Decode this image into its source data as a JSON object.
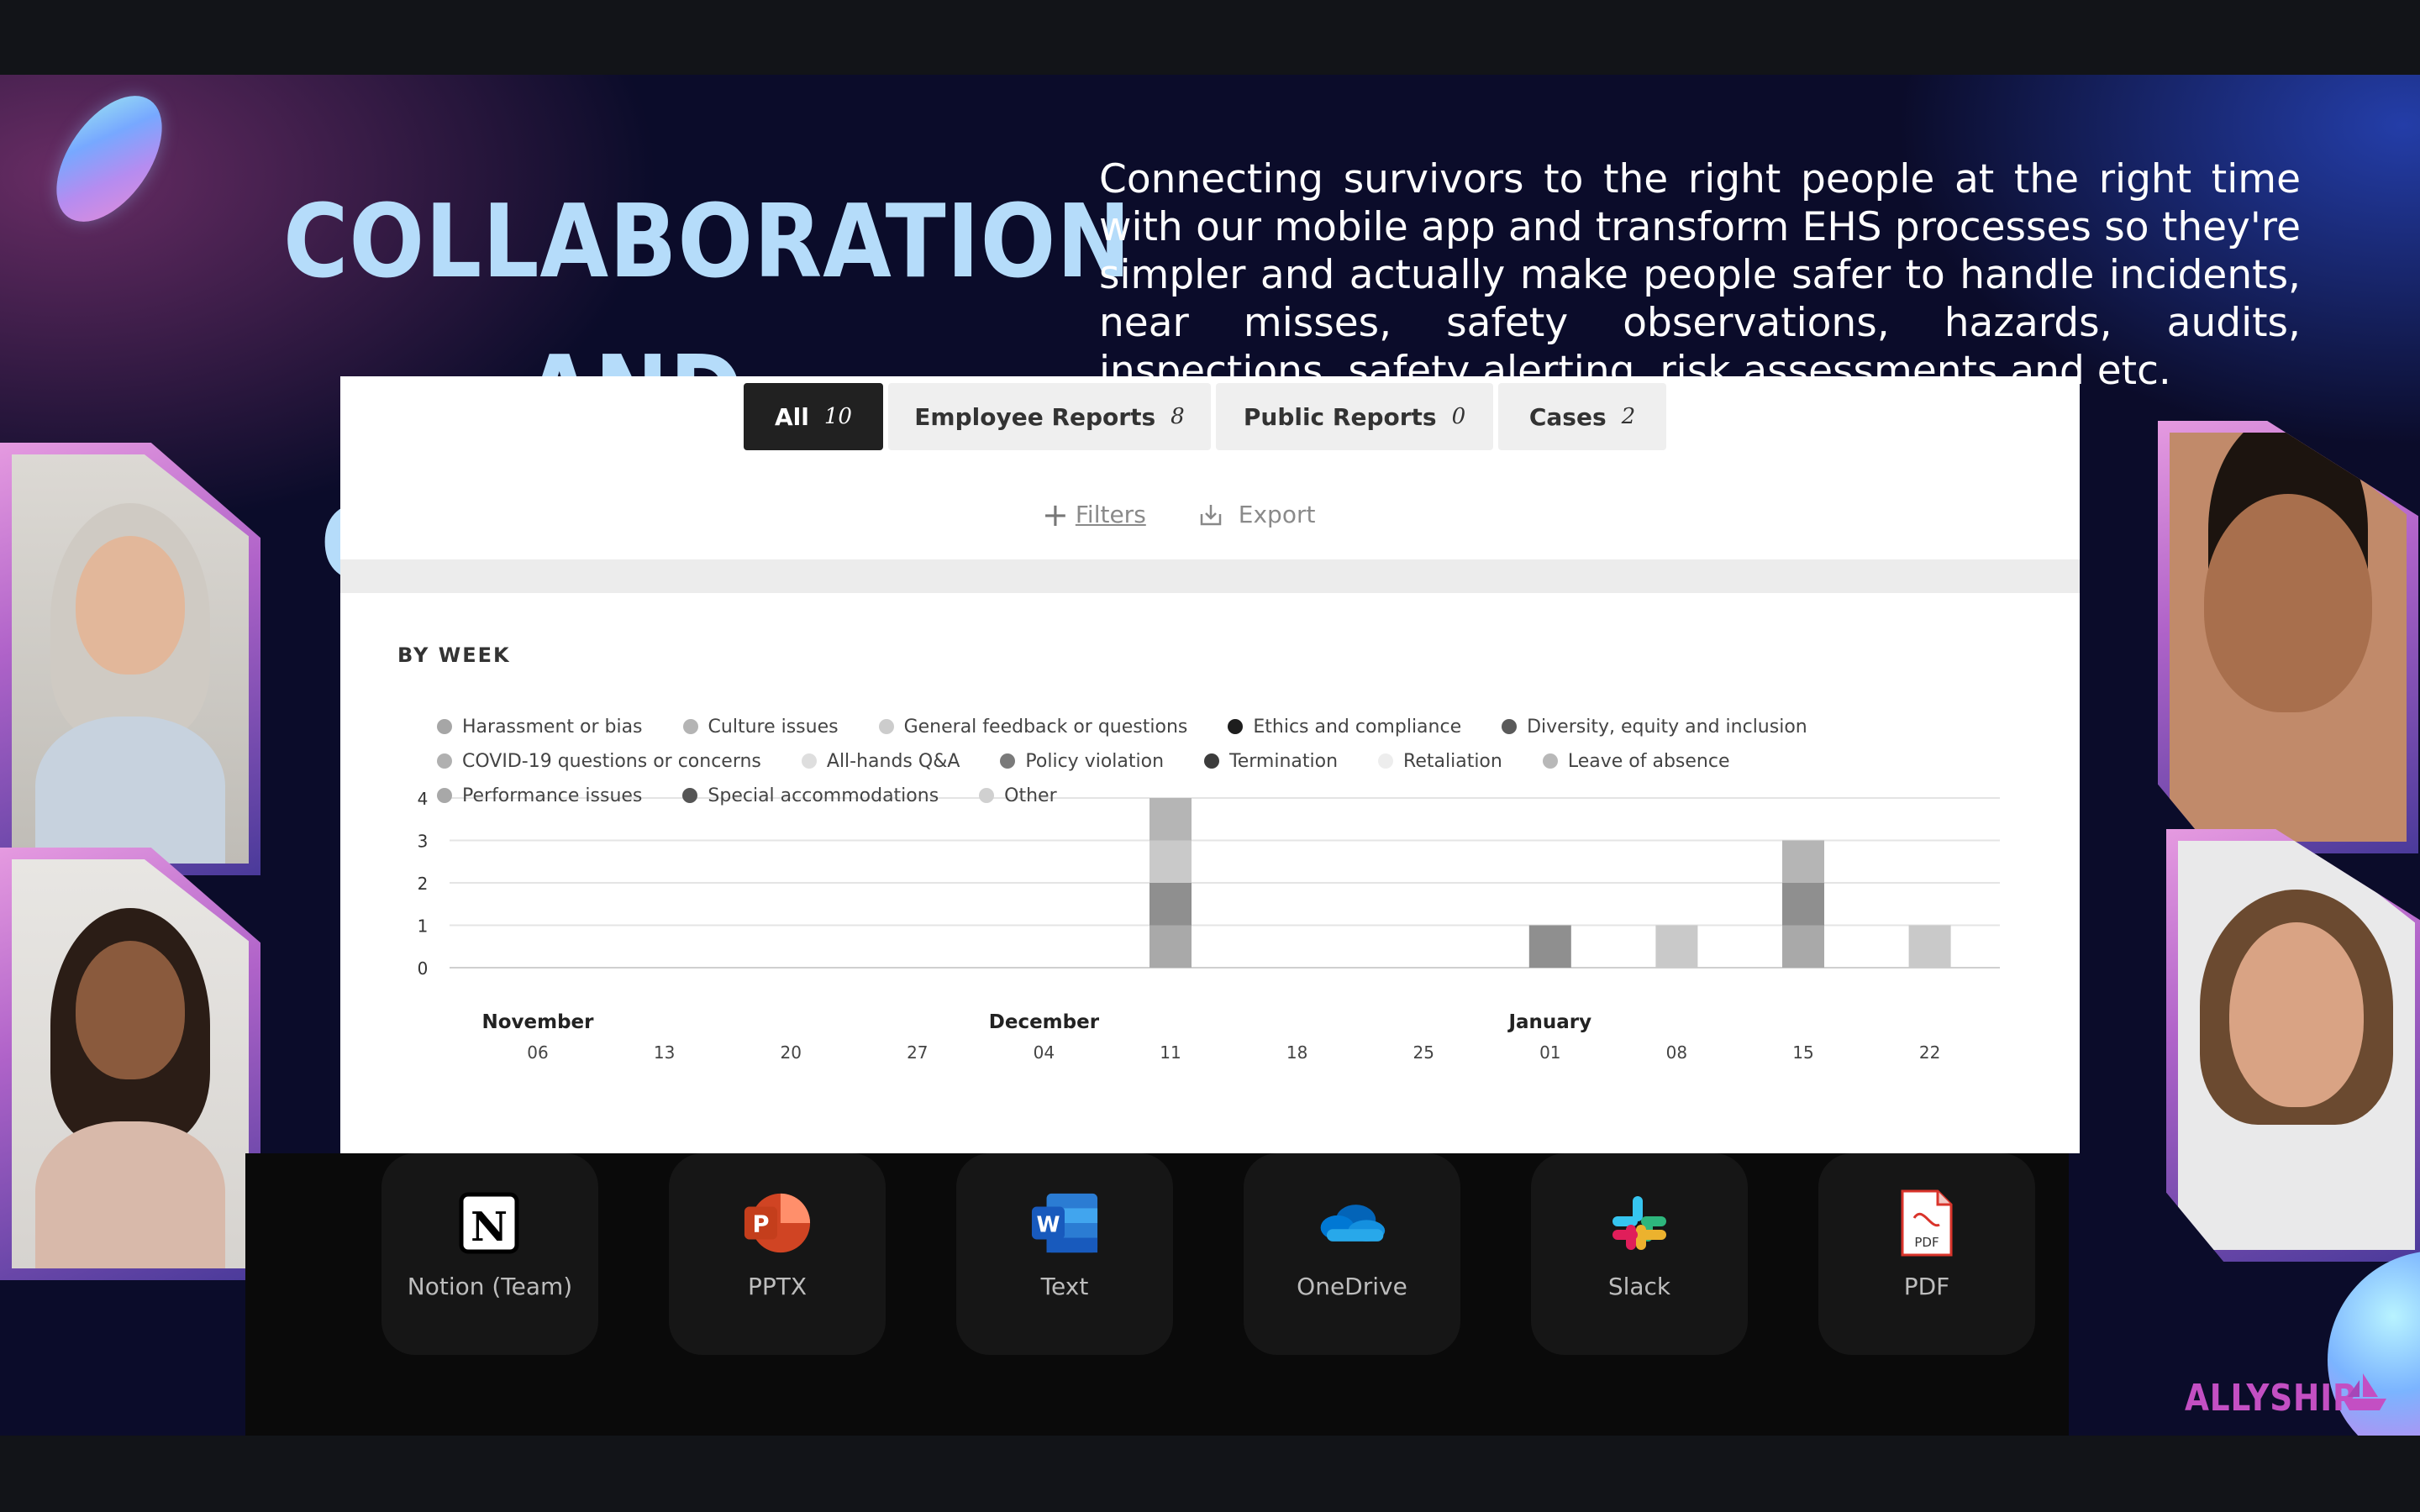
{
  "slide": {
    "title_line1": "COLLABORATION",
    "title_line2": "AND COMMUNITY",
    "description": "Connecting survivors to the right people at the right time with our mobile app and transform EHS processes so they're simpler and actually make people safer to handle incidents, near misses, safety observations, hazards, audits, inspections, safety alerting, risk assessments and etc.",
    "brand": "ALLYSHIP"
  },
  "tabs": [
    {
      "label": "All",
      "count": "10",
      "active": true
    },
    {
      "label": "Employee Reports",
      "count": "8",
      "active": false
    },
    {
      "label": "Public Reports",
      "count": "0",
      "active": false
    },
    {
      "label": "Cases",
      "count": "2",
      "active": false
    }
  ],
  "toolbar": {
    "filters_label": "Filters",
    "export_label": "Export"
  },
  "chart_section": {
    "heading": "BY WEEK"
  },
  "chart_data": {
    "type": "bar",
    "stacked": true,
    "title": "BY WEEK",
    "ylim": [
      0,
      4
    ],
    "yticks": [
      0,
      1,
      2,
      3,
      4
    ],
    "categories": [
      "06",
      "13",
      "20",
      "27",
      "04",
      "11",
      "18",
      "25",
      "01",
      "08",
      "15",
      "22"
    ],
    "month_labels": [
      {
        "label": "November",
        "at": "06"
      },
      {
        "label": "December",
        "at": "04"
      },
      {
        "label": "January",
        "at": "01"
      }
    ],
    "series": [
      {
        "name": "Harassment or bias",
        "values": [
          0,
          0,
          0,
          0,
          0,
          1,
          0,
          0,
          0,
          0,
          1,
          0
        ]
      },
      {
        "name": "Ethics and compliance",
        "values": [
          0,
          0,
          0,
          0,
          0,
          1,
          0,
          0,
          1,
          0,
          1,
          0
        ]
      },
      {
        "name": "General feedback or questions",
        "values": [
          0,
          0,
          0,
          0,
          0,
          1,
          0,
          0,
          0,
          1,
          0,
          1
        ]
      },
      {
        "name": "Culture issues",
        "values": [
          0,
          0,
          0,
          0,
          0,
          1,
          0,
          0,
          0,
          0,
          1,
          0
        ]
      }
    ],
    "grid": true,
    "legend_position": "bottom"
  },
  "legend": {
    "row1": [
      {
        "label": "Harassment or bias",
        "color": "#a6a6a6"
      },
      {
        "label": "Culture issues",
        "color": "#b4b4b4"
      },
      {
        "label": "General feedback or questions",
        "color": "#cccccc"
      },
      {
        "label": "Ethics and compliance",
        "color": "#1e1e1e"
      },
      {
        "label": "Diversity, equity and inclusion",
        "color": "#5a5a5a"
      }
    ],
    "row2": [
      {
        "label": "COVID-19 questions or concerns",
        "color": "#b0b0b0"
      },
      {
        "label": "All-hands Q&A",
        "color": "#dedede"
      },
      {
        "label": "Policy violation",
        "color": "#7a7a7a"
      },
      {
        "label": "Termination",
        "color": "#3c3c3c"
      },
      {
        "label": "Retaliation",
        "color": "#ededed"
      },
      {
        "label": "Leave of absence",
        "color": "#b8b8b8"
      }
    ],
    "row3": [
      {
        "label": "Performance issues",
        "color": "#a8a8a8"
      },
      {
        "label": "Special accommodations",
        "color": "#555555"
      },
      {
        "label": "Other",
        "color": "#d0d0d0"
      }
    ]
  },
  "apps": [
    {
      "label": "Notion (Team)",
      "icon": "notion-icon"
    },
    {
      "label": "PPTX",
      "icon": "powerpoint-icon"
    },
    {
      "label": "Text",
      "icon": "word-icon"
    },
    {
      "label": "OneDrive",
      "icon": "onedrive-icon"
    },
    {
      "label": "Slack",
      "icon": "slack-icon"
    },
    {
      "label": "PDF",
      "icon": "pdf-icon"
    }
  ],
  "icon_text": {
    "notion": "N",
    "powerpoint": "P",
    "word": "W",
    "pdf": "PDF"
  }
}
